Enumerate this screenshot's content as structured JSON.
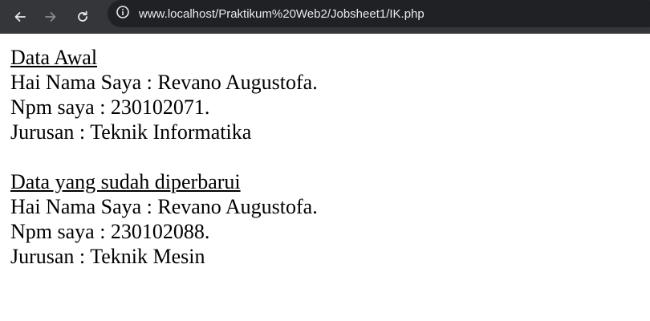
{
  "browser": {
    "back_icon": "arrow-left-icon",
    "forward_icon": "arrow-right-icon",
    "reload_icon": "reload-icon",
    "site_info_icon": "info-circle-icon",
    "url": "www.localhost/Praktikum%20Web2/Jobsheet1/IK.php"
  },
  "page": {
    "section1": {
      "heading": "Data Awal",
      "lines": [
        "Hai Nama Saya : Revano Augustofa.",
        "Npm saya : 230102071.",
        "Jurusan : Teknik Informatika"
      ]
    },
    "section2": {
      "heading": "Data yang sudah diperbarui",
      "lines": [
        "Hai Nama Saya : Revano Augustofa.",
        "Npm saya : 230102088.",
        "Jurusan : Teknik Mesin"
      ]
    }
  }
}
